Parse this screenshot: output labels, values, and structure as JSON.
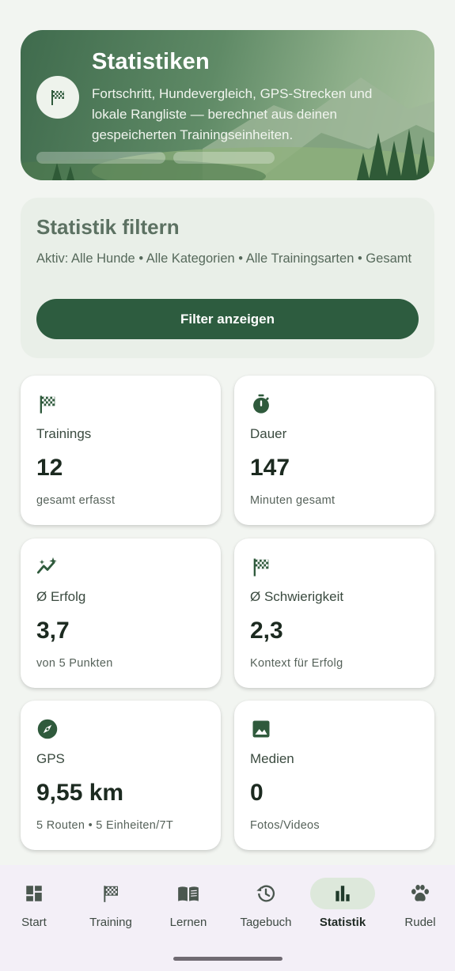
{
  "hero": {
    "title": "Statistiken",
    "subtitle": "Fortschritt, Hundevergleich, GPS-Strecken und lokale Rangliste — berechnet aus deinen gespeicherten Trainingseinheiten.",
    "icon": "checkered-flag-icon"
  },
  "filter": {
    "title": "Statistik filtern",
    "active_text": "Aktiv: Alle Hunde • Alle Kategorien • Alle Trainingsarten • Gesamt",
    "button_label": "Filter anzeigen"
  },
  "stats": [
    {
      "label": "Trainings",
      "value": "12",
      "sub": "gesamt erfasst",
      "icon": "checkered-flag-icon"
    },
    {
      "label": "Dauer",
      "value": "147",
      "sub": "Minuten gesamt",
      "icon": "stopwatch-icon"
    },
    {
      "label": "Ø Erfolg",
      "value": "3,7",
      "sub": "von 5 Punkten",
      "icon": "trending-sparkle-icon"
    },
    {
      "label": "Ø Schwierigkeit",
      "value": "2,3",
      "sub": "Kontext für Erfolg",
      "icon": "checkered-flag-icon"
    },
    {
      "label": "GPS",
      "value": "9,55 km",
      "sub": "5 Routen • 5 Einheiten/7T",
      "icon": "compass-icon"
    },
    {
      "label": "Medien",
      "value": "0",
      "sub": "Fotos/Videos",
      "icon": "image-icon"
    }
  ],
  "nav": {
    "items": [
      {
        "label": "Start",
        "icon": "dashboard-icon",
        "active": false
      },
      {
        "label": "Training",
        "icon": "checkered-flag-icon",
        "active": false
      },
      {
        "label": "Lernen",
        "icon": "book-icon",
        "active": false
      },
      {
        "label": "Tagebuch",
        "icon": "history-icon",
        "active": false
      },
      {
        "label": "Statistik",
        "icon": "bar-chart-icon",
        "active": true
      },
      {
        "label": "Rudel",
        "icon": "paw-icon",
        "active": false
      }
    ]
  },
  "colors": {
    "background": "#f2f5f1",
    "accent": "#2d5c3f",
    "icon_green": "#2f5a3c",
    "nav_background": "#f3eff7",
    "nav_active_pill": "#dde8db"
  }
}
